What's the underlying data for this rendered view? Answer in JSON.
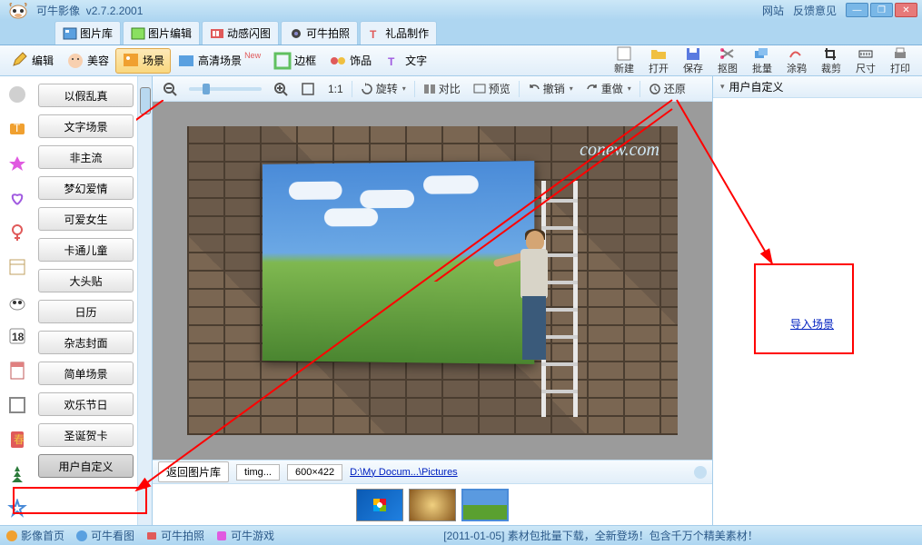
{
  "titlebar": {
    "appname": "可牛影像",
    "version": "v2.7.2.2001",
    "link_website": "网站",
    "link_feedback": "反馈意见"
  },
  "maintabs": [
    {
      "label": "图片库",
      "icon": "gallery-icon"
    },
    {
      "label": "图片编辑",
      "icon": "edit-icon"
    },
    {
      "label": "动感闪图",
      "icon": "flash-icon"
    },
    {
      "label": "可牛拍照",
      "icon": "camera-icon"
    },
    {
      "label": "礼品制作",
      "icon": "gift-icon"
    }
  ],
  "toolbar_left": [
    {
      "label": "编辑",
      "icon": "pencil-icon"
    },
    {
      "label": "美容",
      "icon": "face-icon"
    },
    {
      "label": "场景",
      "icon": "scene-icon",
      "active": true
    },
    {
      "label": "高清场景",
      "icon": "hd-icon",
      "badge": "New"
    },
    {
      "label": "边框",
      "icon": "frame-icon"
    },
    {
      "label": "饰品",
      "icon": "decor-icon"
    },
    {
      "label": "文字",
      "icon": "text-icon"
    }
  ],
  "toolbar_right": [
    {
      "label": "新建"
    },
    {
      "label": "打开"
    },
    {
      "label": "保存"
    },
    {
      "label": "抠图"
    },
    {
      "label": "批量"
    },
    {
      "label": "涂鸦"
    },
    {
      "label": "裁剪"
    },
    {
      "label": "尺寸"
    },
    {
      "label": "打印"
    }
  ],
  "sidebar_items": [
    "以假乱真",
    "文字场景",
    "非主流",
    "梦幻爱情",
    "可爱女生",
    "卡通儿童",
    "大头贴",
    "日历",
    "杂志封面",
    "简单场景",
    "欢乐节日",
    "圣诞贺卡",
    "用户自定义"
  ],
  "viewtools": {
    "ratio": "1:1",
    "rotate": "旋转",
    "compare": "对比",
    "preview": "预览",
    "undo": "撤销",
    "redo": "重做",
    "restore": "还原"
  },
  "canvas": {
    "watermark": "conew.com"
  },
  "infobar": {
    "back": "返回图片库",
    "filename": "timg...",
    "dims": "600×422",
    "path": "D:\\My Docum...\\Pictures"
  },
  "rightpanel": {
    "title": "用户自定义",
    "import_link": "导入场景"
  },
  "statusbar": {
    "items": [
      "影像首页",
      "可牛看图",
      "可牛拍照",
      "可牛游戏"
    ],
    "promo": "[2011-01-05] 素材包批量下载，全新登场！包含千万个精美素材！"
  }
}
